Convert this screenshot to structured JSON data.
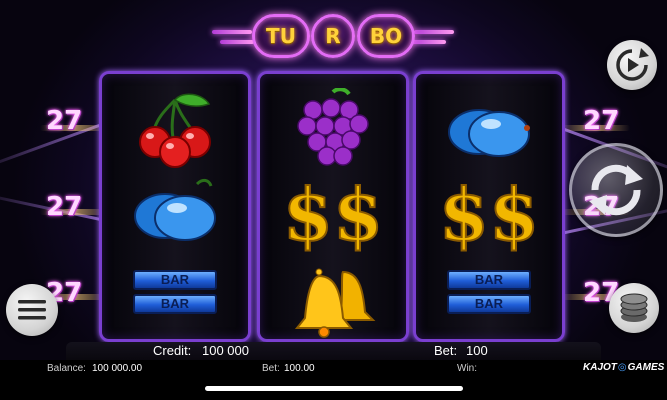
{
  "game": {
    "logo_letters": [
      "TU",
      "R",
      "BO"
    ]
  },
  "paylines": {
    "left": [
      "27",
      "27",
      "27"
    ],
    "right": [
      "27",
      "27",
      "27"
    ]
  },
  "reels": [
    {
      "symbols": [
        "cherries",
        "plum",
        "double-bar"
      ]
    },
    {
      "symbols": [
        "grapes",
        "dollar",
        "bells"
      ]
    },
    {
      "symbols": [
        "plum",
        "dollar",
        "double-bar"
      ]
    }
  ],
  "bar_label": "BAR",
  "info_bar": {
    "credit_label": "Credit:",
    "credit_value": "100 000",
    "bet_label": "Bet:",
    "bet_value": "100"
  },
  "status_bar": {
    "balance_label": "Balance:",
    "balance_value": "100 000.00",
    "bet_label": "Bet:",
    "bet_value": "100.00",
    "win_label": "Win:",
    "win_value": "",
    "brand_left": "KAJOT",
    "brand_right": "GAMES"
  },
  "controls": {
    "autoplay_icon": "play-circle-icon",
    "spin_icon": "spin-arrows-icon",
    "bet_icon": "coin-stack-icon",
    "menu_icon": "hamburger-menu-icon"
  },
  "colors": {
    "reel_border": "#7a3fd0",
    "logo_ring": "#e36cf5",
    "logo_text": "#ffd23a",
    "payline_text": "#ffd8ff",
    "bar_blue": "#1f5ed8"
  }
}
